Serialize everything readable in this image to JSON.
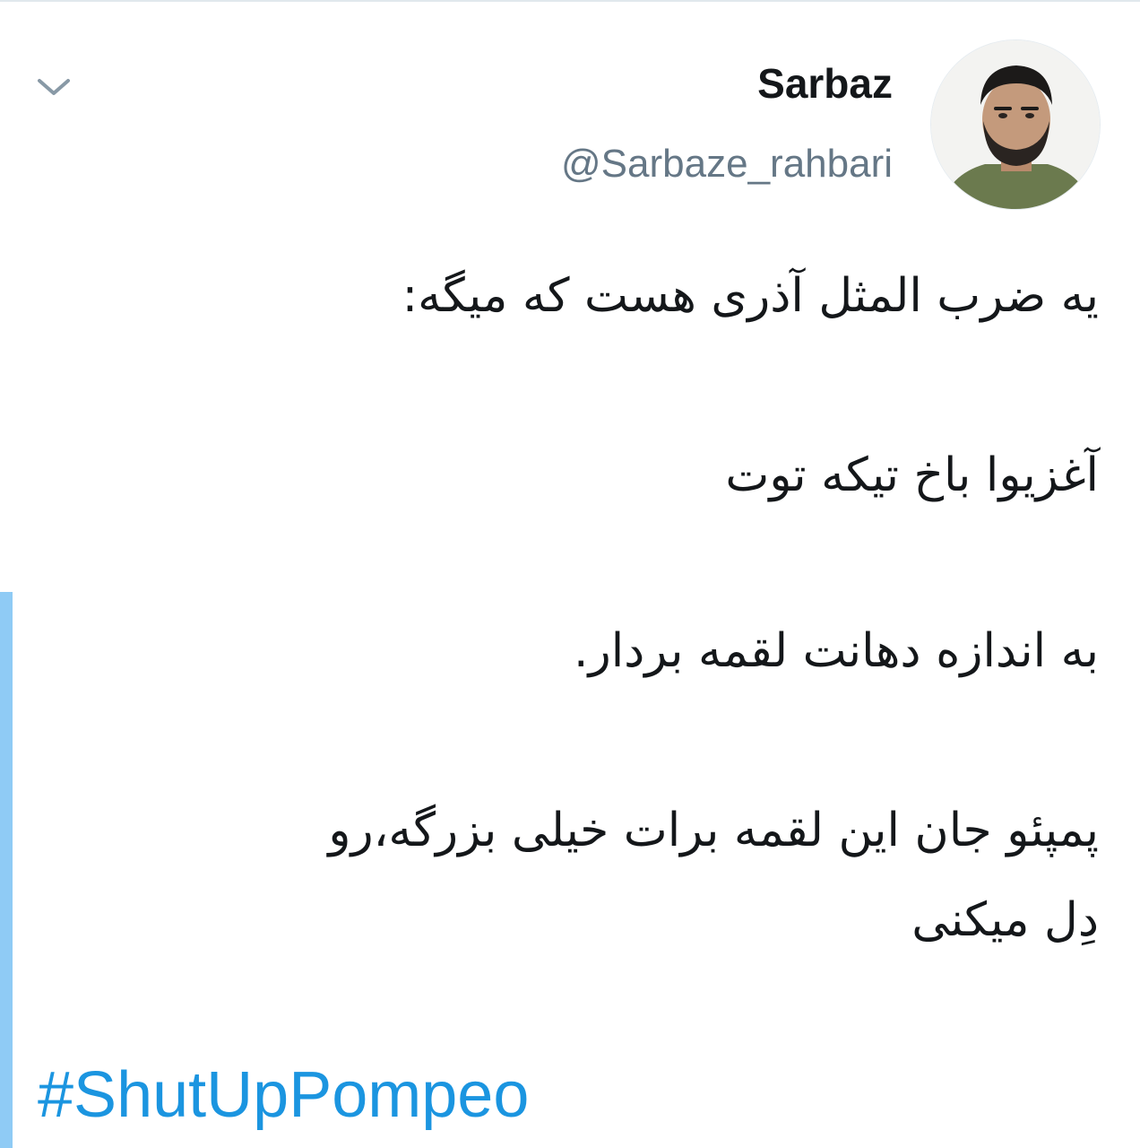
{
  "author": {
    "display_name": "Sarbaz",
    "handle": "@Sarbaze_rahbari",
    "avatar_icon": "user-photo-avatar"
  },
  "tweet": {
    "lines": [
      "یه ضرب المثل آذری هست که میگه:",
      "آغزیوا باخ تیکه توت",
      "به اندازه دهانت لقمه بردار.",
      "پمپئو جان این لقمه برات خیلی بزرگه،رو",
      "دِل میکنی"
    ],
    "hashtag": "#ShutUpPompeo"
  },
  "icons": {
    "menu": "chevron-down-icon"
  },
  "colors": {
    "text_primary": "#14171a",
    "text_secondary": "#657786",
    "link": "#1b95e0",
    "thread_line": "#8fcbf5",
    "divider": "#e1e8ed"
  }
}
